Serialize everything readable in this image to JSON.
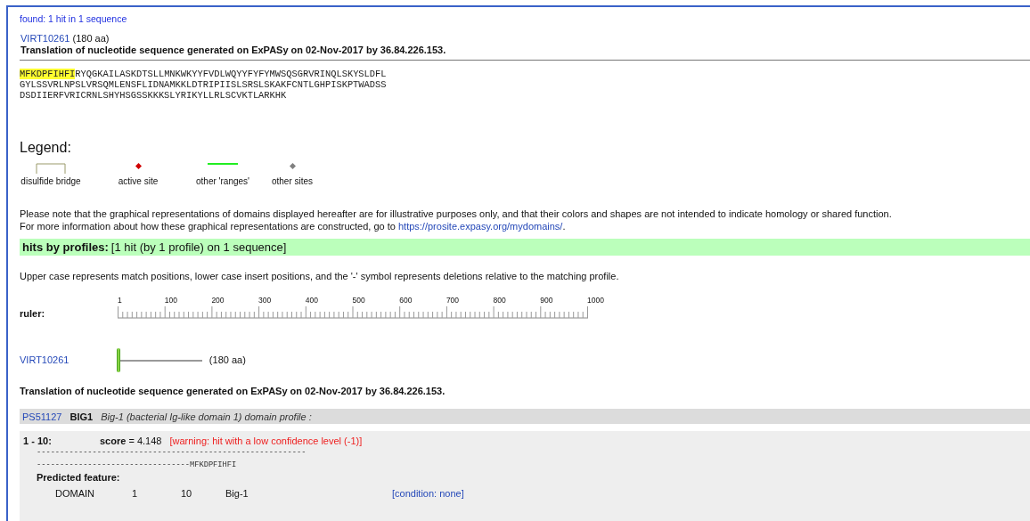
{
  "summary": "found: 1 hit in 1 sequence",
  "sequence": {
    "id": "VIRT10261",
    "length": "(180 aa)",
    "description": "Translation of nucleotide sequence generated on ExPASy on 02-Nov-2017 by 36.84.226.153.",
    "highlight": "MFKDPFIHFI",
    "lines": [
      "RYQGKAILASKDTSLLMNKWKYYFVDLWQYYFYFYMWSQSGRVRINQLSKYSLDFL",
      "GYLSSVRLNPSLVRSQMLENSFLIDNAMKKLDTRIPIISLSRSLSKAKFCNTLGHPISKPTWADSS",
      "DSDIIERFVRICRNLSHYHSGSSKKKSLYRIKYLLRLSCVKTLARKHK"
    ]
  },
  "legend": {
    "title": "Legend:",
    "items": [
      {
        "kind": "bridge",
        "label": "disulfide bridge"
      },
      {
        "kind": "active",
        "label": "active site"
      },
      {
        "kind": "range",
        "label": "other 'ranges'"
      },
      {
        "kind": "site",
        "label": "other sites"
      }
    ]
  },
  "note": {
    "line1": "Please note that the graphical representations of domains displayed hereafter are for illustrative purposes only, and that their colors and shapes are not intended to indicate homology or shared function.",
    "line2": "For more information about how these graphical representations are constructed, go to",
    "link": "https://prosite.expasy.org/mydomains/",
    "after": "."
  },
  "hits_header": {
    "label": "hits by profiles:",
    "summary": "[1 hit (by 1 profile) on 1 sequence]"
  },
  "case_note": "Upper case represents match positions, lower case insert positions, and the '-' symbol represents deletions relative to the matching profile.",
  "ruler": {
    "label": "ruler:",
    "ticks": [
      "1",
      "100",
      "200",
      "300",
      "400",
      "500",
      "600",
      "700",
      "800",
      "900",
      "1000"
    ]
  },
  "hit_row": {
    "id": "VIRT10261",
    "length": "(180 aa)",
    "level": 0.18
  },
  "hit_description": "Translation of nucleotide sequence generated on ExPASy on 02-Nov-2017 by 36.84.226.153.",
  "profile": {
    "accession": "PS51127",
    "name": "BIG1",
    "description": "Big-1 (bacterial Ig-like domain 1) domain profile :"
  },
  "match": {
    "range": "1 - 10:",
    "score_label": "score",
    "score": "= 4.148",
    "warning": "[warning: hit with a low confidence level (-1)]",
    "alignment": [
      "----------------------------------------------------------",
      "---------------------------------MFKDPFIHFI"
    ],
    "feature_title": "Predicted feature:",
    "feature": {
      "type": "DOMAIN",
      "start": "1",
      "end": "10",
      "name": "Big-1",
      "condition": "[condition: none]"
    }
  }
}
